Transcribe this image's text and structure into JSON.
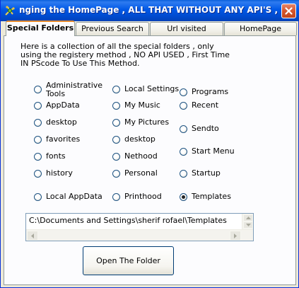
{
  "window": {
    "title": "nging the HomePage , ALL THAT WITHOUT ANY API'S , A ...",
    "close_label": "✕"
  },
  "tabs": [
    {
      "label": "Special Folders",
      "active": true
    },
    {
      "label": "Previous Search",
      "active": false
    },
    {
      "label": "Url visited",
      "active": false
    },
    {
      "label": "HomePage",
      "active": false
    }
  ],
  "panel": {
    "description": "Here is a collection of all the special folders , only using the registery method , NO API USED , First Time IN PScode To Use This Method.",
    "radios": {
      "col1": [
        "Administrative Tools",
        "AppData",
        "desktop",
        "favorites",
        "fonts",
        "history",
        "Local AppData"
      ],
      "col2": [
        "Local Settings",
        "My Music",
        "My Pictures",
        "desktop",
        "Nethood",
        "Personal",
        "Printhood"
      ],
      "col3": [
        "Programs",
        "Recent",
        "Sendto",
        "Start Menu",
        "Startup",
        "Templates"
      ]
    },
    "selected": "Templates",
    "path_value": "C:\\Documents and Settings\\sherif rofael\\Templates",
    "open_button_label": "Open The Folder"
  }
}
